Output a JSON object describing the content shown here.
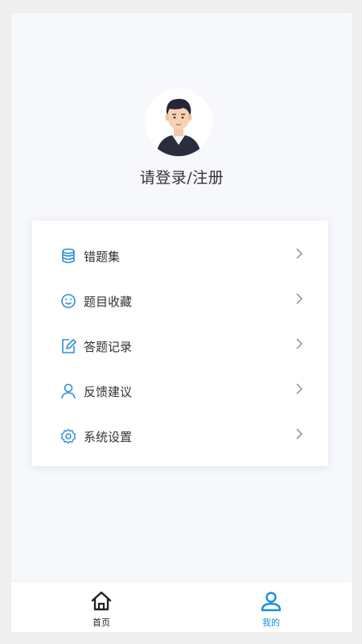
{
  "profile": {
    "login_label": "请登录/注册"
  },
  "menu": {
    "items": [
      {
        "label": "错题集",
        "icon": "database-icon"
      },
      {
        "label": "题目收藏",
        "icon": "smiley-icon"
      },
      {
        "label": "答题记录",
        "icon": "edit-icon"
      },
      {
        "label": "反馈建议",
        "icon": "user-icon"
      },
      {
        "label": "系统设置",
        "icon": "settings-icon"
      }
    ]
  },
  "tabbar": {
    "tabs": [
      {
        "label": "首页",
        "icon": "home-icon",
        "active": false
      },
      {
        "label": "我的",
        "icon": "user-icon",
        "active": true
      }
    ]
  },
  "colors": {
    "accent": "#1a8fe0",
    "icon_blue": "#2f8fd8",
    "text": "#333333",
    "background": "#f7f8fc"
  }
}
